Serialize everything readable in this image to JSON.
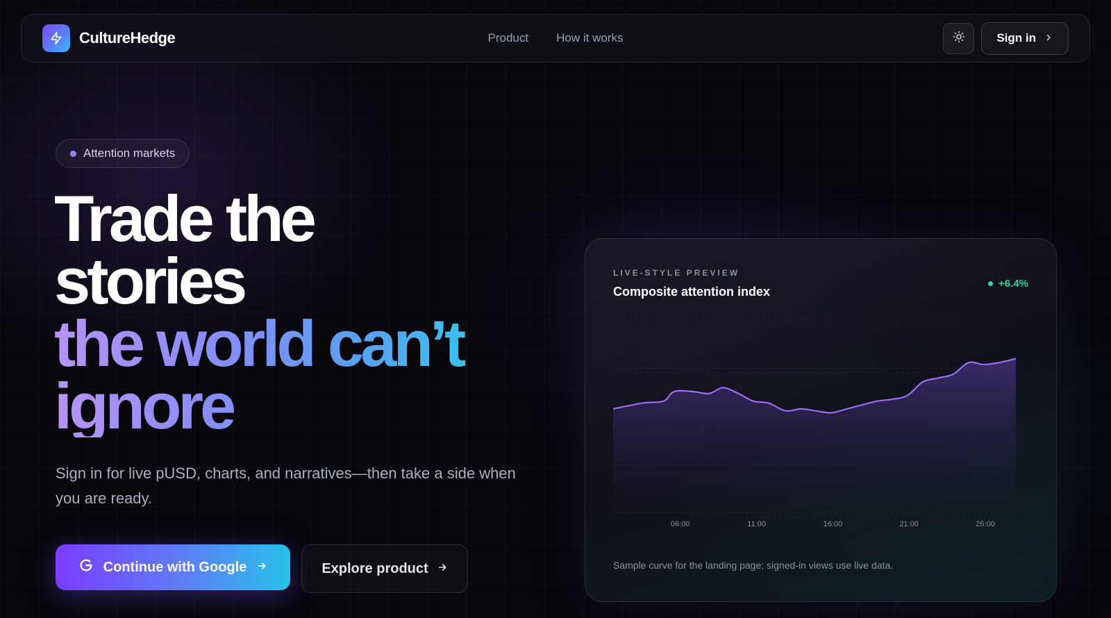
{
  "brand": {
    "name": "CultureHedge",
    "icon": "lightning-icon"
  },
  "nav": {
    "links": [
      "Product",
      "How it works"
    ],
    "theme_icon": "sun-icon",
    "signin_label": "Sign in"
  },
  "hero": {
    "badge": "Attention markets",
    "headline_line1": "Trade the",
    "headline_line2": "stories",
    "headline_line3": "the world can’t",
    "headline_line4": "ignore",
    "subtitle": "Sign in for live pUSD, charts, and narratives—then take a side when you are ready.",
    "cta_primary": "Continue with Google",
    "cta_secondary": "Explore product"
  },
  "preview": {
    "eyebrow": "LIVE-STYLE PREVIEW",
    "title": "Composite attention index",
    "change": "+6.4%",
    "footnote": "Sample curve for the landing page; signed-in views use live data."
  },
  "colors": {
    "accent_purple": "#7a3cff",
    "accent_cyan": "#26c2ea",
    "positive": "#34d399",
    "line": "#9b6cf5"
  },
  "chart_data": {
    "type": "area",
    "title": "Composite attention index",
    "x_tick_labels": [
      "06:00",
      "11:00",
      "16:00",
      "21:00",
      "26:00"
    ],
    "x_ticks": [
      6,
      11,
      16,
      21,
      26
    ],
    "xlim": [
      1.6,
      28
    ],
    "ylim": [
      0,
      100
    ],
    "grid": true,
    "series": [
      {
        "values": [
          [
            1.6,
            54
          ],
          [
            3.5,
            57
          ],
          [
            4.9,
            58
          ],
          [
            5.6,
            63
          ],
          [
            6.8,
            63
          ],
          [
            7.9,
            62
          ],
          [
            8.8,
            65
          ],
          [
            9.8,
            62
          ],
          [
            10.8,
            58
          ],
          [
            11.8,
            57
          ],
          [
            12.9,
            53
          ],
          [
            13.9,
            54
          ],
          [
            14.9,
            53
          ],
          [
            15.9,
            52
          ],
          [
            16.9,
            54
          ],
          [
            17.9,
            56
          ],
          [
            18.9,
            58
          ],
          [
            19.9,
            59
          ],
          [
            20.9,
            61
          ],
          [
            21.9,
            68
          ],
          [
            22.9,
            70
          ],
          [
            23.9,
            72
          ],
          [
            24.9,
            78
          ],
          [
            25.9,
            77
          ],
          [
            26.9,
            78
          ],
          [
            28,
            80
          ]
        ]
      }
    ]
  }
}
